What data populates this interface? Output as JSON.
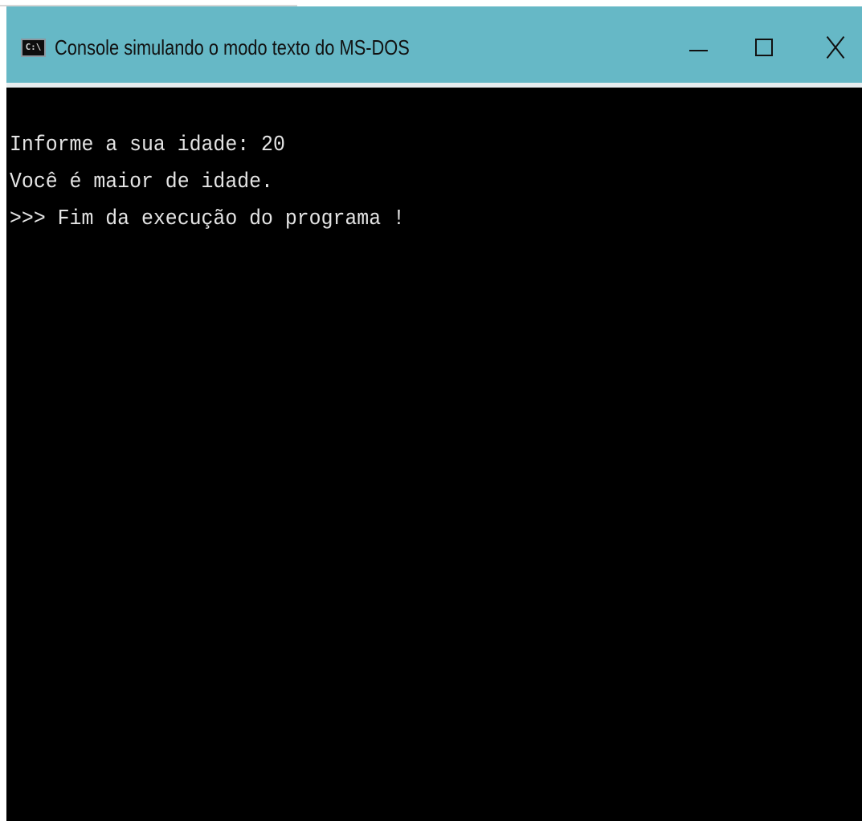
{
  "window": {
    "title": "Console simulando o modo texto do MS-DOS",
    "icon": "console-icon",
    "icon_label": "C:\\",
    "titlebar_color": "#66b8c6",
    "controls": {
      "minimize": "minimize-icon",
      "maximize": "maximize-icon",
      "close": "close-icon"
    }
  },
  "console": {
    "background": "#000000",
    "text_color": "#e4e4e4",
    "lines": [
      "Informe a sua idade: 20",
      "Você é maior de idade.",
      ">>> Fim da execução do programa !"
    ]
  }
}
